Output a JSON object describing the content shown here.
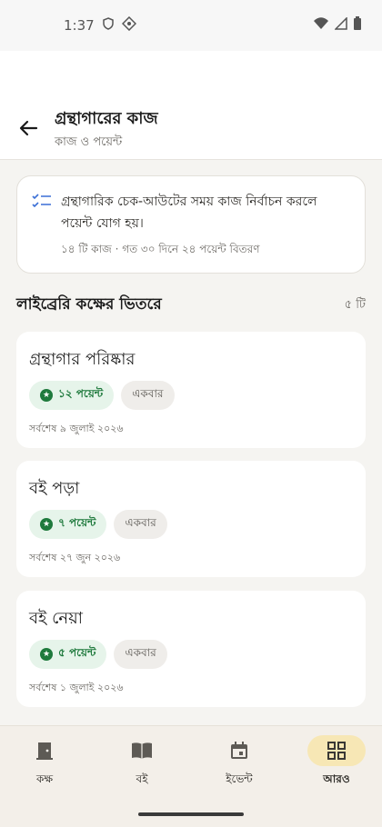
{
  "status_bar": {
    "time": "1:37"
  },
  "header": {
    "title": "গ্রন্থাগারের কাজ",
    "subtitle": "কাজ ও পয়েন্ট"
  },
  "info_card": {
    "text": "গ্রন্থাগারিক চেক-আউটের সময় কাজ নির্বাচন করলে পয়েন্ট যোগ হয়।",
    "meta": "১৪ টি কাজ · গত ৩০ দিনে ২৪ পয়েন্ট বিতরণ"
  },
  "section": {
    "title": "লাইব্রেরি কক্ষের ভিতরে",
    "count": "৫ টি"
  },
  "tasks": [
    {
      "title": "গ্রন্থাগার পরিষ্কার",
      "points": "১২ পয়েন্ট",
      "frequency": "একবার",
      "last": "সর্বশেষ ৯ জুলাই ২০২৬"
    },
    {
      "title": "বই পড়া",
      "points": "৭ পয়েন্ট",
      "frequency": "একবার",
      "last": "সর্বশেষ ২৭ জুন ২০২৬"
    },
    {
      "title": "বই নেয়া",
      "points": "৫ পয়েন্ট",
      "frequency": "একবার",
      "last": "সর্বশেষ ১ জুলাই ২০২৬"
    }
  ],
  "nav": [
    {
      "label": "কক্ষ",
      "icon": "door-icon"
    },
    {
      "label": "বই",
      "icon": "book-icon"
    },
    {
      "label": "ইভেন্ট",
      "icon": "calendar-icon"
    },
    {
      "label": "আরও",
      "icon": "grid-icon",
      "active": true
    }
  ],
  "colors": {
    "accent_green": "#1f7a3d",
    "nav_active": "#f7e7b5"
  }
}
